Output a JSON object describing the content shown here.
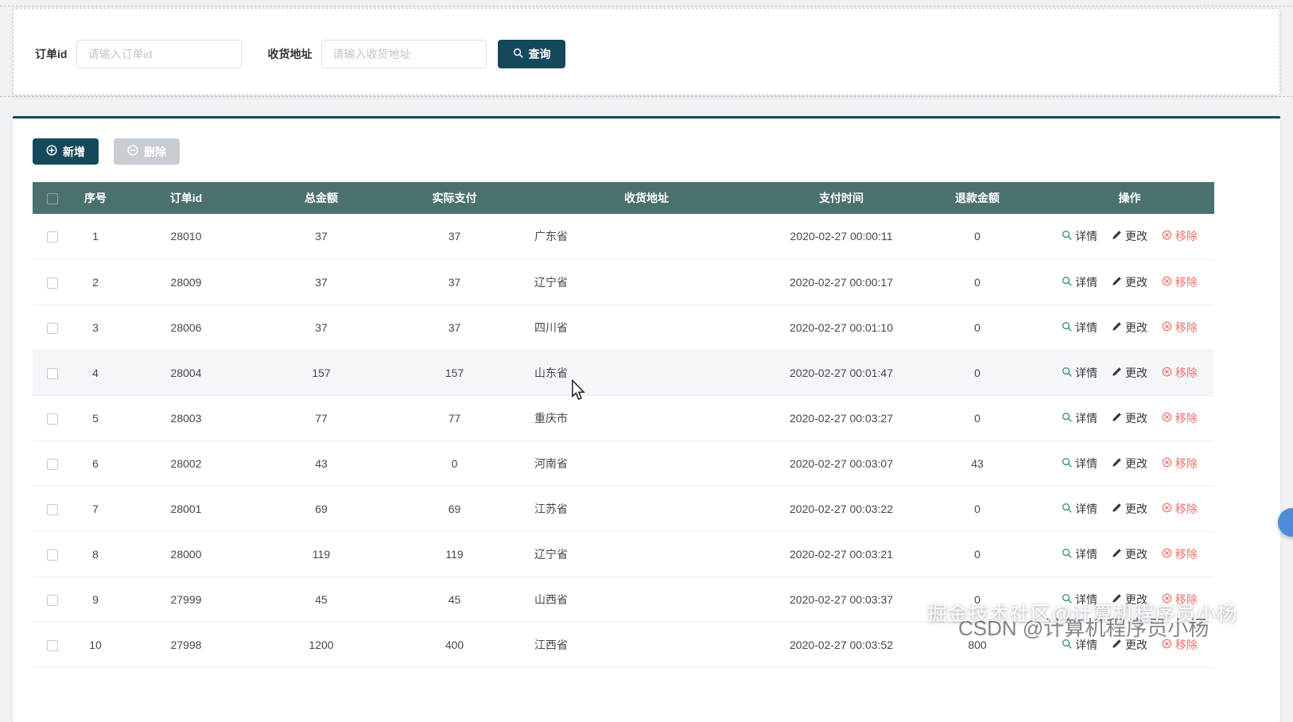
{
  "colors": {
    "accent": "#14495c",
    "header-bg": "#4a716e",
    "detail": "#3c8e87",
    "danger": "#ef6e6a",
    "disabled-btn": "#c8cdd3",
    "link-dark": "#33383d"
  },
  "search": {
    "order_id_label": "订单id",
    "order_id_placeholder": "请输入订单id",
    "address_label": "收货地址",
    "address_placeholder": "请输入收货地址",
    "query_button": "查询"
  },
  "toolbar": {
    "add_button": "新增",
    "delete_button": "删除"
  },
  "table": {
    "columns": [
      "序号",
      "订单id",
      "总金额",
      "实际支付",
      "收货地址",
      "支付时间",
      "退款金额",
      "操作"
    ],
    "actions": {
      "detail": "详情",
      "edit": "更改",
      "remove": "移除"
    },
    "rows": [
      {
        "index": "1",
        "order_id": "28010",
        "total": "37",
        "paid": "37",
        "address": "广东省",
        "pay_time": "2020-02-27 00:00:11",
        "refund": "0"
      },
      {
        "index": "2",
        "order_id": "28009",
        "total": "37",
        "paid": "37",
        "address": "辽宁省",
        "pay_time": "2020-02-27 00:00:17",
        "refund": "0"
      },
      {
        "index": "3",
        "order_id": "28006",
        "total": "37",
        "paid": "37",
        "address": "四川省",
        "pay_time": "2020-02-27 00:01:10",
        "refund": "0"
      },
      {
        "index": "4",
        "order_id": "28004",
        "total": "157",
        "paid": "157",
        "address": "山东省",
        "pay_time": "2020-02-27 00:01:47",
        "refund": "0",
        "hovered": true
      },
      {
        "index": "5",
        "order_id": "28003",
        "total": "77",
        "paid": "77",
        "address": "重庆市",
        "pay_time": "2020-02-27 00:03:27",
        "refund": "0"
      },
      {
        "index": "6",
        "order_id": "28002",
        "total": "43",
        "paid": "0",
        "address": "河南省",
        "pay_time": "2020-02-27 00:03:07",
        "refund": "43"
      },
      {
        "index": "7",
        "order_id": "28001",
        "total": "69",
        "paid": "69",
        "address": "江苏省",
        "pay_time": "2020-02-27 00:03:22",
        "refund": "0"
      },
      {
        "index": "8",
        "order_id": "28000",
        "total": "119",
        "paid": "119",
        "address": "辽宁省",
        "pay_time": "2020-02-27 00:03:21",
        "refund": "0"
      },
      {
        "index": "9",
        "order_id": "27999",
        "total": "45",
        "paid": "45",
        "address": "山西省",
        "pay_time": "2020-02-27 00:03:37",
        "refund": "0"
      },
      {
        "index": "10",
        "order_id": "27998",
        "total": "1200",
        "paid": "400",
        "address": "江西省",
        "pay_time": "2020-02-27 00:03:52",
        "refund": "800"
      }
    ]
  },
  "watermarks": {
    "juejin": "掘金技术社区@计算机程序员小杨",
    "csdn": "CSDN @计算机程序员小杨"
  }
}
